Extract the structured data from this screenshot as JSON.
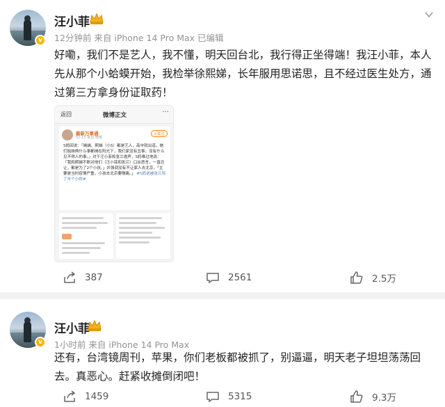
{
  "posts": [
    {
      "author": "汪小菲",
      "meta": "12分钟前 来自 iPhone 14 Pro Max 已编辑",
      "content": "好嘞，我们不是艺人，我不懂，明天回台北，我行得正坐得端！我汪小菲，本人先从那个小蛤蟆开始，我检举徐熙娣，长年服用思诺思，且不经过医生处方，通过第三方拿身份证取药！",
      "embedded_screenshot": {
        "back": "返回",
        "title": "微博正文",
        "more": "···",
        "user": "最新万事通",
        "meta": "02-15 来自 微博",
        "follow": "+关注",
        "text": "S妈回说：「嫣嫣、熙娣（小S）都是艺人，高中就出道，她们姐妹俩什么事都摊在阳光下，我们家没有丑事，没有什么见不得人的事。」对于汪小菲和张兰炮声，S妈难过地说：「我和熙娣不断对他们（汪小菲和张兰）口出恶言，一直忍让，都是为了2个小孩。」并强调没有不让家人去北京，「主要是当时疫情严重，小孩去北京要隔离。」",
        "tag": "#S妈说被张兰骂了半个小时#"
      },
      "stats": {
        "share": "387",
        "comment": "2561",
        "like": "2.5万"
      }
    },
    {
      "author": "汪小菲",
      "meta": "1小时前 来自 iPhone 14 Pro Max",
      "content": "还有，台湾镜周刊，苹果，你们老板都被抓了，别逼逼，明天老子坦坦荡荡回去。真恶心。赶紧收摊倒闭吧！",
      "stats": {
        "share": "1459",
        "comment": "5315",
        "like": "9.3万"
      }
    }
  ],
  "icons": {
    "share": "share-icon",
    "comment": "comment-icon",
    "like": "like-icon",
    "more": "chevron-down-icon",
    "badge": "verified-badge-icon",
    "crown": "crown-icon"
  },
  "colors": {
    "meta": "#939393",
    "badge": "#f7b500",
    "background": "#ffffff",
    "separator": "#f2f2f2"
  }
}
